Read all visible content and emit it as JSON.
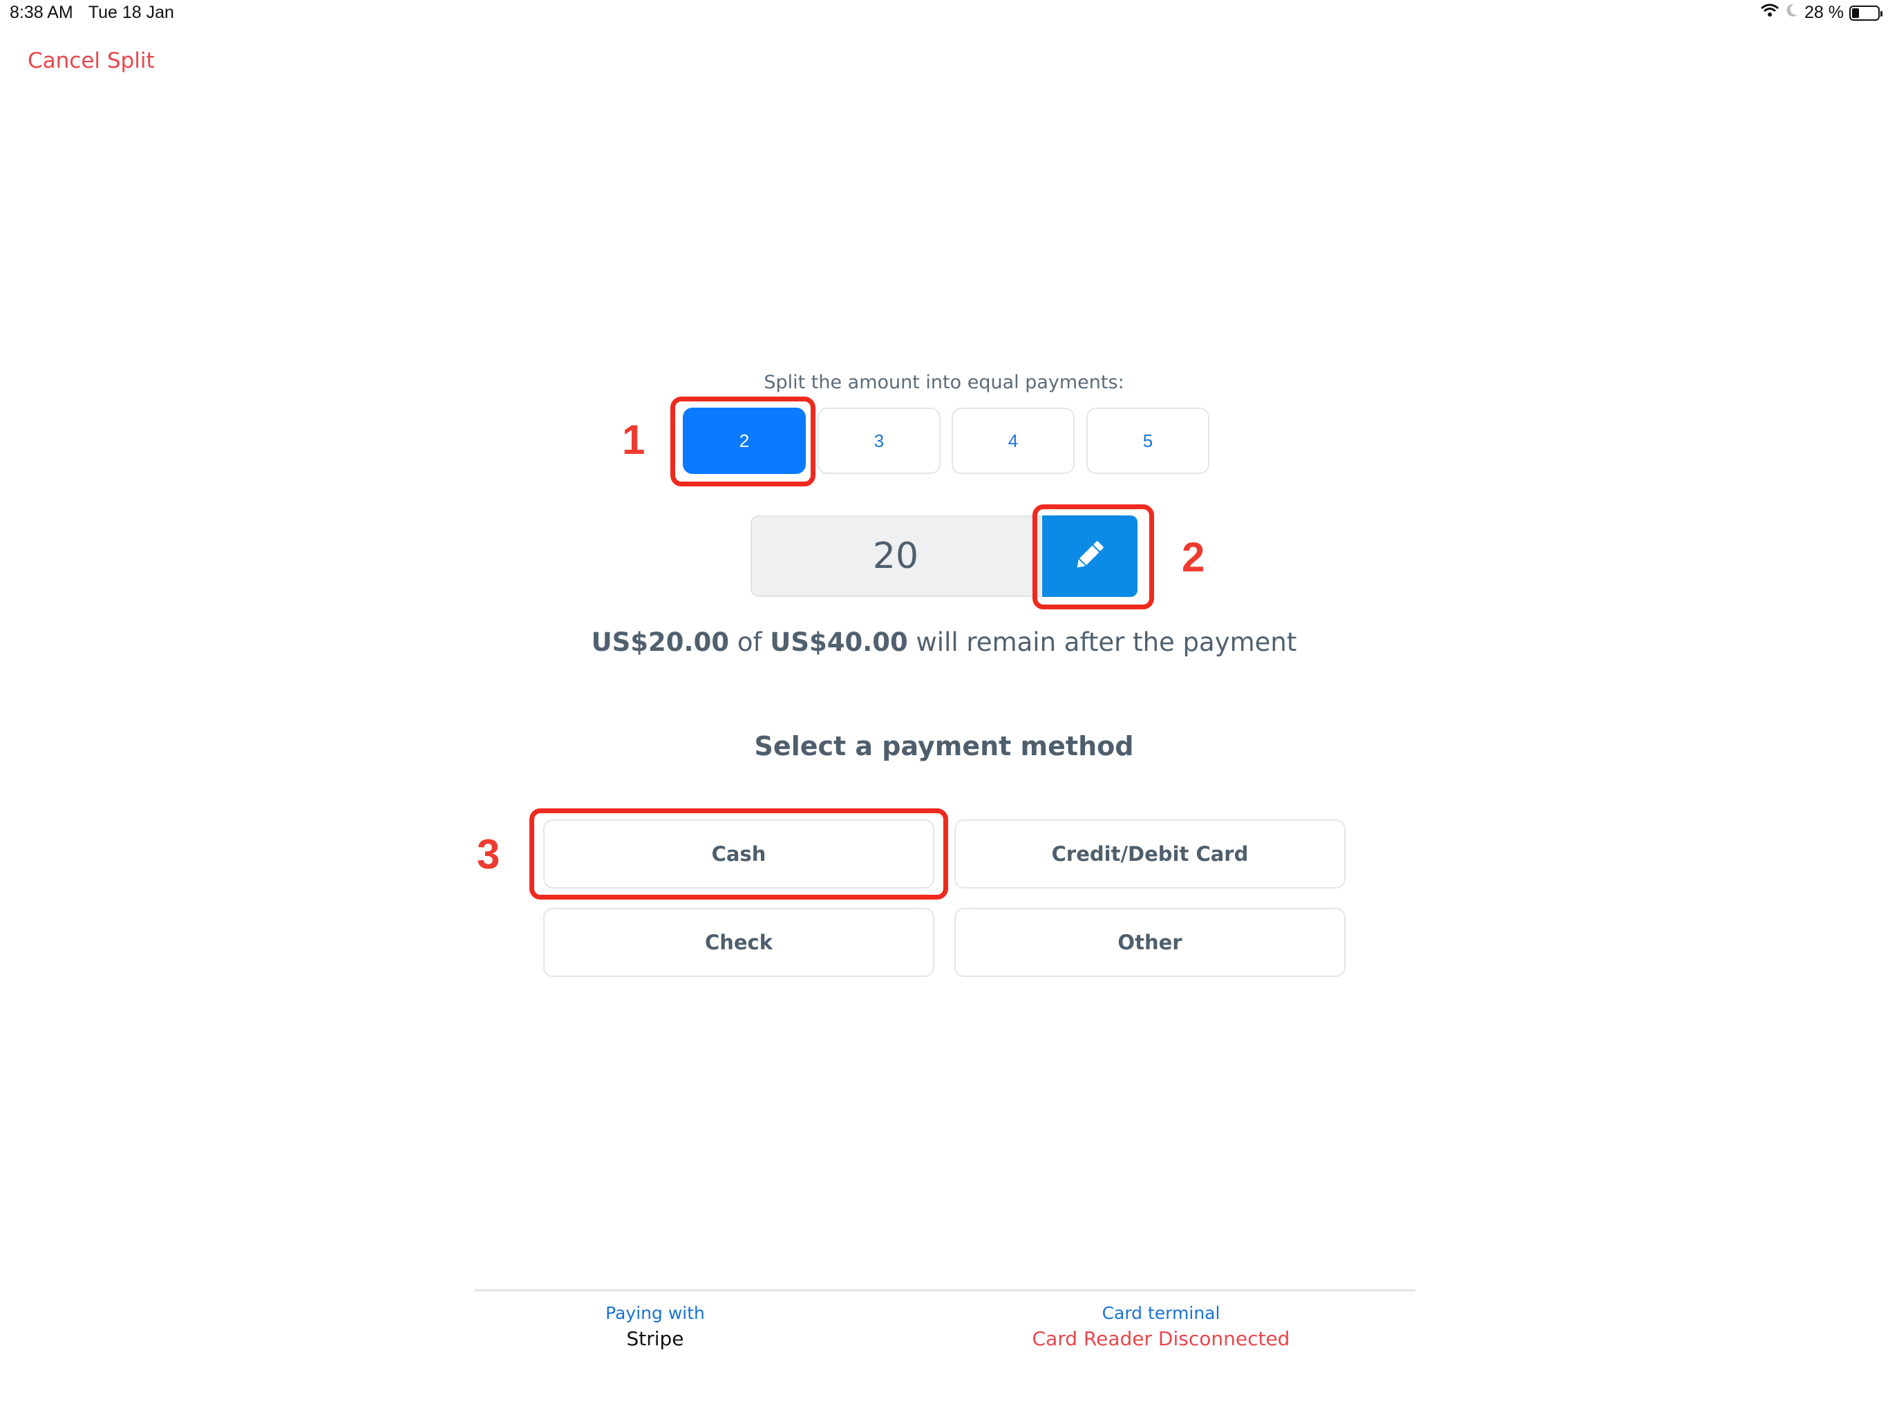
{
  "status_bar": {
    "time": "8:38 AM",
    "date": "Tue 18 Jan",
    "battery_text": "28 %",
    "battery_level": 0.28,
    "icons": [
      "wifi-icon",
      "moon-icon",
      "battery-icon"
    ]
  },
  "nav": {
    "cancel_label": "Cancel Split"
  },
  "split": {
    "label": "Split the amount into equal payments:",
    "options": [
      "2",
      "3",
      "4",
      "5"
    ],
    "selected": "2"
  },
  "amount": {
    "value": "20",
    "edit_icon": "pencil-icon"
  },
  "remain": {
    "remaining": "US$20.00",
    "of": "of",
    "total": "US$40.00",
    "suffix": "will remain after the payment"
  },
  "payment_methods": {
    "title": "Select a payment method",
    "options": [
      "Cash",
      "Credit/Debit Card",
      "Check",
      "Other"
    ]
  },
  "annotations": [
    "1",
    "2",
    "3"
  ],
  "colors": {
    "accent": "#0a7bff",
    "edit_button": "#0b8be6",
    "danger": "#e8474d",
    "annotation": "#ee2a1f"
  },
  "footer": {
    "paying_with_label": "Paying with",
    "paying_with_value": "Stripe",
    "terminal_label": "Card terminal",
    "terminal_value": "Card Reader Disconnected"
  }
}
